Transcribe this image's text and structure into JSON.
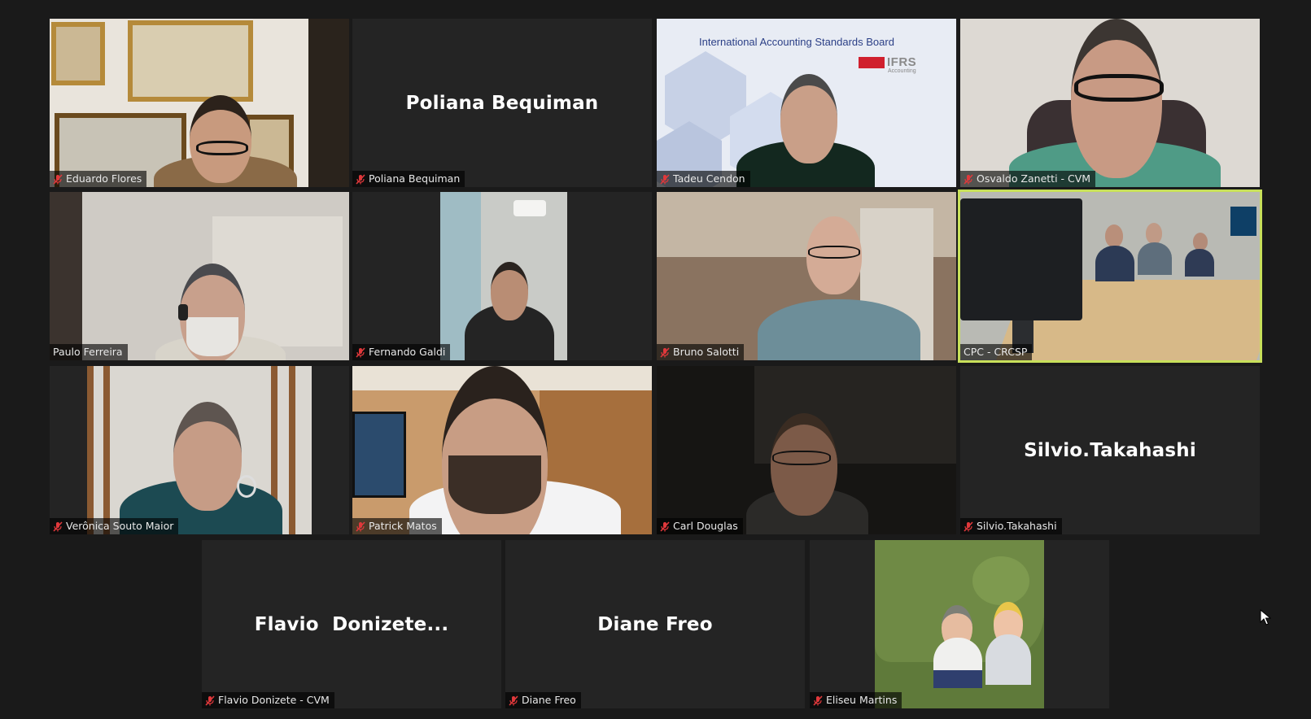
{
  "participants": [
    {
      "name": "Eduardo Flores",
      "muted": true
    },
    {
      "name": "Poliana Bequiman",
      "muted": true,
      "display_name": "Poliana Bequiman"
    },
    {
      "name": "Tadeu Cendon",
      "muted": true,
      "banner_title": "International Accounting Standards Board",
      "banner_logo": "IFRS",
      "banner_logo_sub": "Accounting"
    },
    {
      "name": "Osvaldo Zanetti - CVM",
      "muted": true
    },
    {
      "name": "Paulo Ferreira",
      "muted": false
    },
    {
      "name": "Fernando Galdi",
      "muted": true
    },
    {
      "name": "Bruno Salotti",
      "muted": true
    },
    {
      "name": "CPC - CRCSP",
      "muted": false,
      "active_speaker": true
    },
    {
      "name": "Verônica Souto Maior",
      "muted": true
    },
    {
      "name": "Patrick Matos",
      "muted": true
    },
    {
      "name": "Carl Douglas",
      "muted": true
    },
    {
      "name": "Silvio.Takahashi",
      "muted": true,
      "display_name": "Silvio.Takahashi"
    },
    {
      "name": "Flavio Donizete - CVM",
      "muted": true,
      "display_name": "Flavio  Donizete..."
    },
    {
      "name": "Diane Freo",
      "muted": true,
      "display_name": "Diane Freo"
    },
    {
      "name": "Eliseu Martins",
      "muted": true
    }
  ],
  "colors": {
    "background": "#1a1a1a",
    "tile": "#242424",
    "active_outline": "#c8e05a",
    "mute_icon": "#e0383b"
  },
  "icons": {
    "muted": "microphone-muted-icon",
    "cursor": "mouse-pointer-icon"
  }
}
